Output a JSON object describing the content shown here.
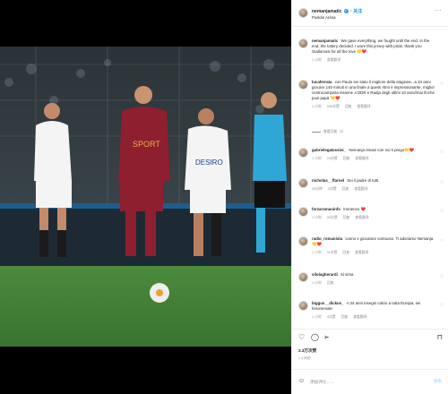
{
  "post": {
    "username": "nemanjamatic",
    "follow_label": "关注",
    "location": "Puskás Aréna",
    "more_label": "···"
  },
  "comments": [
    {
      "username": "nemanjamatic",
      "text": "We gave everything, we fought until the end. In the end, the lottery decided. I wore this jersey with pride, thank you Giallorossi for all the love 💛❤️",
      "time": "1 小时",
      "translate": "查看翻译"
    },
    {
      "username": "lucaferrata",
      "text": "con Paulo sei stato il migliore della stagione...a 34 anni giocare 140 minuti in una finale a questi ritmi è impressionante, miglior centrocampista insieme a DDR e Radja degli ultimi 10 anni//mai finché puoi papà 💛❤️",
      "time": "1 小时",
      "likes": "536次赞",
      "reply": "回复",
      "translate": "查看翻译",
      "view_replies": "查看回复（4）"
    },
    {
      "username": "gabrielegalassini_",
      "text": "Nemanja rimani con noi ti prego💛❤️",
      "time": "1 小时",
      "likes": "19次赞",
      "reply": "回复",
      "translate": "查看翻译"
    },
    {
      "username": "nicholas__ffarnel",
      "text": "Sei il padre di tutti.",
      "time": "33分钟",
      "likes": "3次赞",
      "reply": "回复",
      "translate": "查看翻译"
    },
    {
      "username": "forzaromaninfo",
      "text": "Immenso ❤️",
      "time": "1 小时",
      "likes": "20次赞",
      "reply": "回复",
      "translate": "查看翻译"
    },
    {
      "username": "radio_romanista",
      "text": "Uomo e giocatore sontuoso. Ti adoriamo Nemanja 💛❤️",
      "time": "1 小时",
      "likes": "11次赞",
      "reply": "回复",
      "translate": "查看翻译"
    },
    {
      "username": "vilolagherardi",
      "text": "Si sima",
      "time": "1 小时",
      "reply": "回复"
    },
    {
      "username": "biggus__dickus_",
      "text": "A 34 anni insegni calcio a tutta Europa, sei fenomenale",
      "time": "1 小时",
      "likes": "4次赞",
      "reply": "回复",
      "translate": "查看翻译"
    }
  ],
  "icons": {
    "like": "heart-icon",
    "comment": "comment-icon",
    "share": "share-icon",
    "save": "bookmark-icon",
    "emoji": "emoji-icon",
    "more": "more-icon"
  },
  "footer": {
    "likes_count": "3.3万次赞",
    "time_ago": "1 小时前",
    "add_comment_placeholder": "添加评论……",
    "post_label": "发布"
  },
  "colors": {
    "accent": "#0095f6",
    "muted": "#8e8e8e",
    "roma": "#8e1f2f",
    "sevilla": "#f4f4f4"
  }
}
